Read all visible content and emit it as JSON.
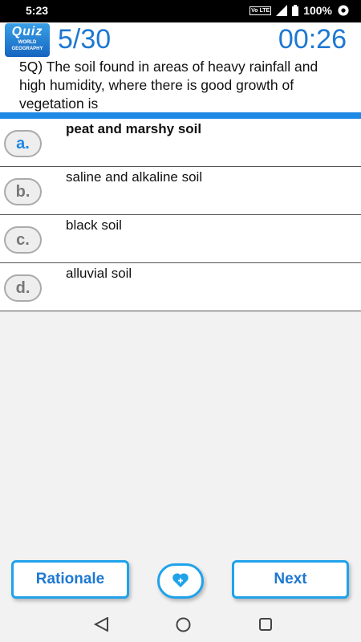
{
  "status": {
    "time": "5:23",
    "network": "Vo LTE",
    "battery": "100%",
    "icons": [
      "wifi-icon",
      "signal-icon",
      "battery-icon"
    ]
  },
  "header": {
    "logo_title": "Quiz",
    "logo_subtitle": "WORLD GEOGRAPHY",
    "progress": "5/30",
    "timer": "00:26"
  },
  "question": {
    "text": "5Q) The soil found in areas of heavy rainfall and high humidity, where there is good growth of vegetation is"
  },
  "options": [
    {
      "letter": "a.",
      "text": "peat and marshy soil",
      "highlighted": true
    },
    {
      "letter": "b.",
      "text": "saline and alkaline soil",
      "highlighted": false
    },
    {
      "letter": "c.",
      "text": "black soil",
      "highlighted": false
    },
    {
      "letter": "d.",
      "text": "alluvial soil",
      "highlighted": false
    }
  ],
  "footer": {
    "rationale_label": "Rationale",
    "next_label": "Next",
    "favorite_icon": "heart-plus-icon"
  },
  "navigation": {
    "icons": [
      "back-icon",
      "home-icon",
      "recents-icon"
    ]
  },
  "colors": {
    "accent": "#1e78d2",
    "divider": "#1e88e5",
    "button_border": "#1fa2ea",
    "background": "#f2f2f2"
  }
}
